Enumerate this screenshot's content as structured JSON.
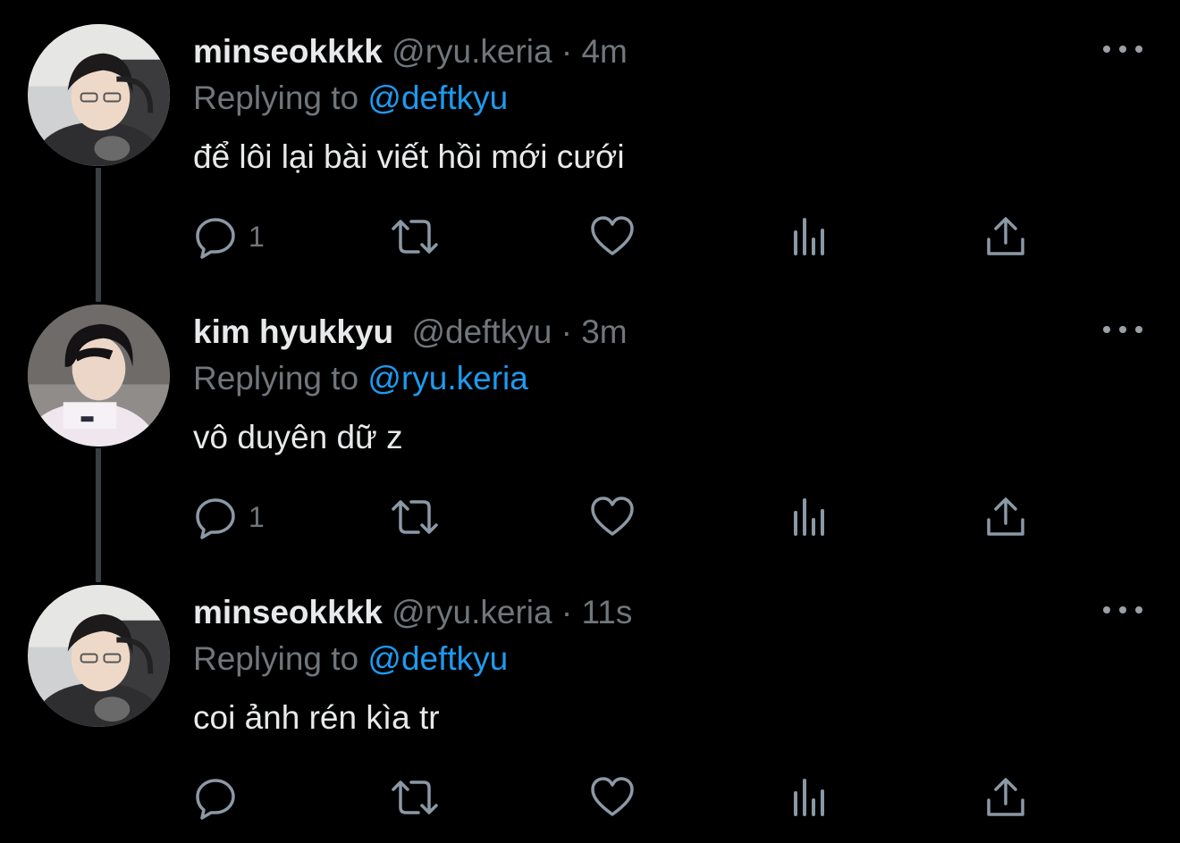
{
  "tweets": [
    {
      "name": "minseokkkk",
      "handle": "@ryu.keria",
      "dot": "·",
      "time": "4m",
      "replying_prefix": "Replying to",
      "replying_to": "@deftkyu",
      "text": "để lôi lại bài viết hồi mới cưới",
      "reply_count": "1",
      "avatar_icon": "avatar-minseokkkk"
    },
    {
      "name": "kim hyukkyu",
      "handle": "@deftkyu",
      "dot": "·",
      "time": "3m",
      "replying_prefix": "Replying to",
      "replying_to": "@ryu.keria",
      "text": "vô duyên dữ z",
      "reply_count": "1",
      "avatar_icon": "avatar-kim-hyukkyu"
    },
    {
      "name": "minseokkkk",
      "handle": "@ryu.keria",
      "dot": "·",
      "time": "11s",
      "replying_prefix": "Replying to",
      "replying_to": "@deftkyu",
      "text": "coi ảnh rén kìa tr",
      "reply_count": "",
      "avatar_icon": "avatar-minseokkkk"
    }
  ],
  "colors": {
    "background": "#000000",
    "text": "#e7e9ea",
    "muted": "#71767b",
    "accent": "#1d9bf0",
    "icon": "#8b98a5",
    "thread_line": "#3a3f44"
  },
  "icons": {
    "reply": "reply-icon",
    "retweet": "retweet-icon",
    "like": "heart-icon",
    "views": "views-icon",
    "share": "share-icon",
    "more": "more-options-icon"
  }
}
